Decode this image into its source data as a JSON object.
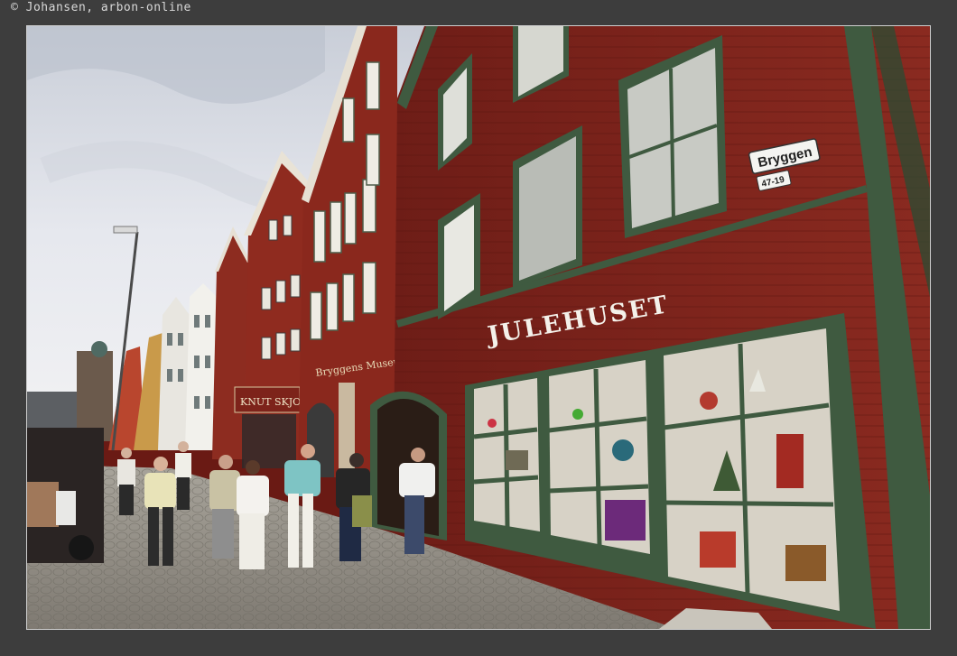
{
  "credit": "© Johansen, arbon-online",
  "photo": {
    "shop_sign": "JULEHUSET",
    "street_sign": "Bryggen",
    "street_number": "47-19",
    "neighbor_sign": "KNUT SKJOTVET"
  },
  "colors": {
    "page_background": "#3d3d3d",
    "facade_red": "#7a211a",
    "trim_green": "#3f5a40",
    "sky": "#dfe3ea",
    "cobblestone": "#8f8a82"
  }
}
